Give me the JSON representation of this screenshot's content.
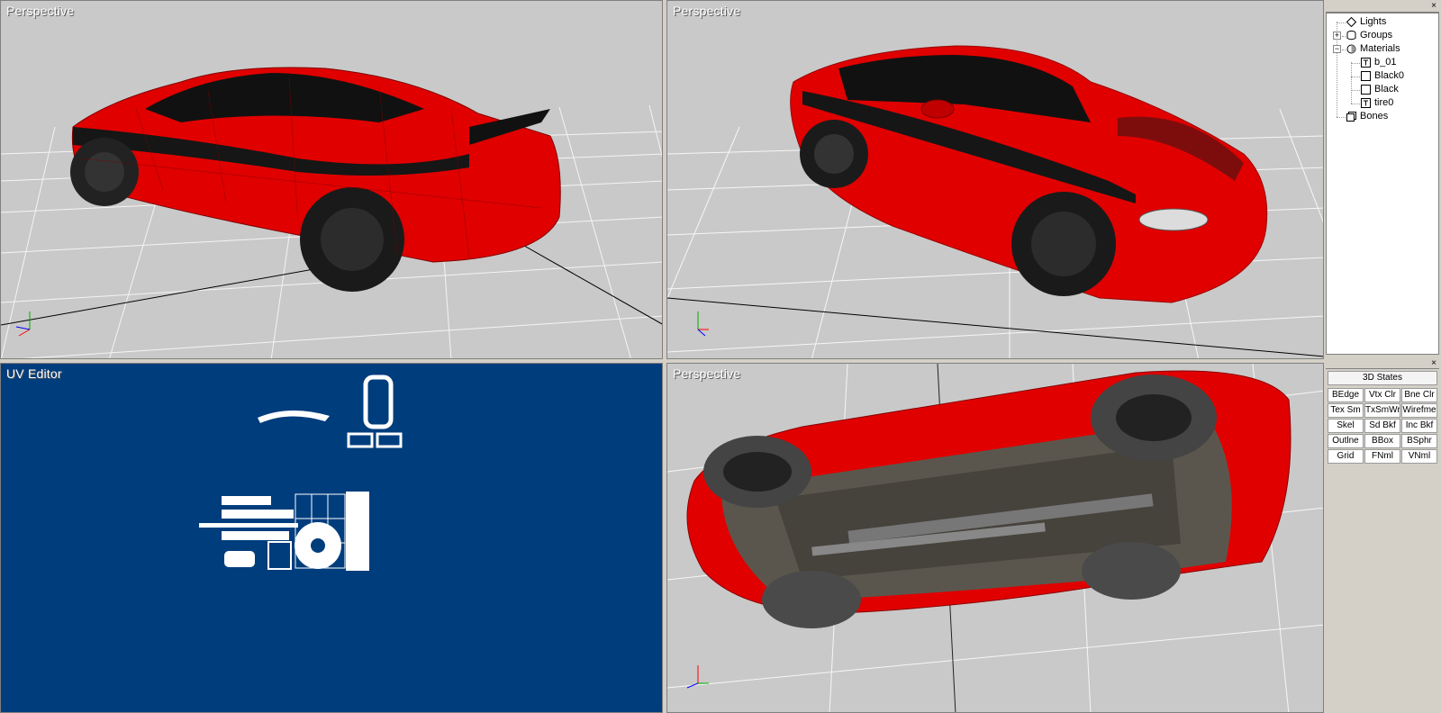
{
  "viewports": {
    "top_left": {
      "title": "Perspective"
    },
    "top_right": {
      "title": "Perspective"
    },
    "bottom_left": {
      "title": "UV Editor"
    },
    "bottom_right": {
      "title": "Perspective"
    }
  },
  "axis": {
    "x": "X",
    "y": "Y",
    "z": "Z"
  },
  "scene_tree": {
    "items": [
      {
        "label": "Lights",
        "icon": "light-icon",
        "level": 0,
        "expander": ""
      },
      {
        "label": "Groups",
        "icon": "group-icon",
        "level": 0,
        "expander": "+"
      },
      {
        "label": "Materials",
        "icon": "material-icon",
        "level": 0,
        "expander": "−"
      },
      {
        "label": "b_01",
        "icon": "texture-icon",
        "level": 1,
        "expander": ""
      },
      {
        "label": "Black0",
        "icon": "material-swatch-icon",
        "level": 1,
        "expander": ""
      },
      {
        "label": "Black",
        "icon": "material-swatch-icon",
        "level": 1,
        "expander": ""
      },
      {
        "label": "tire0",
        "icon": "texture-icon",
        "level": 1,
        "expander": ""
      },
      {
        "label": "Bones",
        "icon": "bone-icon",
        "level": 0,
        "expander": ""
      }
    ]
  },
  "states_panel": {
    "header": "3D States",
    "buttons": [
      [
        "BEdge",
        "Vtx Clr",
        "Bne Clr"
      ],
      [
        "Tex Sm",
        "TxSmWr",
        "Wirefme"
      ],
      [
        "Skel",
        "Sd Bkf",
        "Inc Bkf"
      ],
      [
        "Outlne",
        "BBox",
        "BSphr"
      ],
      [
        "Grid",
        "FNml",
        "VNml"
      ]
    ]
  },
  "panel_close": "×",
  "colors": {
    "perspective_bg": "#c9c9c9",
    "uv_bg": "#003d7d",
    "car_body": "#e00000",
    "grid_line": "#ffffff"
  }
}
